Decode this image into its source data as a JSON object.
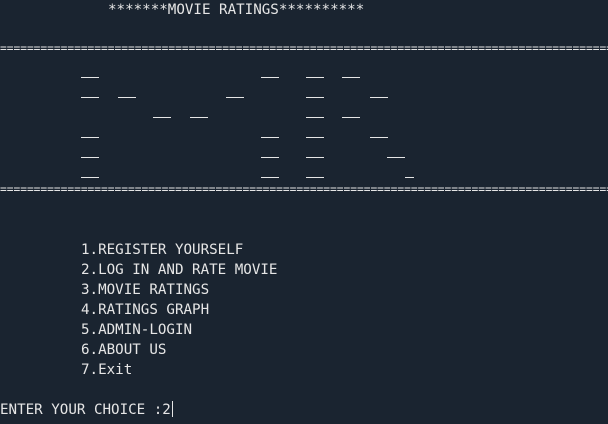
{
  "title": "*******MOVIE RATINGS**********",
  "separator": "===========================================================================================",
  "menu": [
    "1.REGISTER YOURSELF",
    "2.LOG IN AND RATE MOVIE",
    "3.MOVIE RATINGS",
    "4.RATINGS GRAPH",
    "5.ADMIN-LOGIN",
    "6.ABOUT US",
    "7.Exit"
  ],
  "prompt": "ENTER YOUR CHOICE :",
  "input_value": "2"
}
